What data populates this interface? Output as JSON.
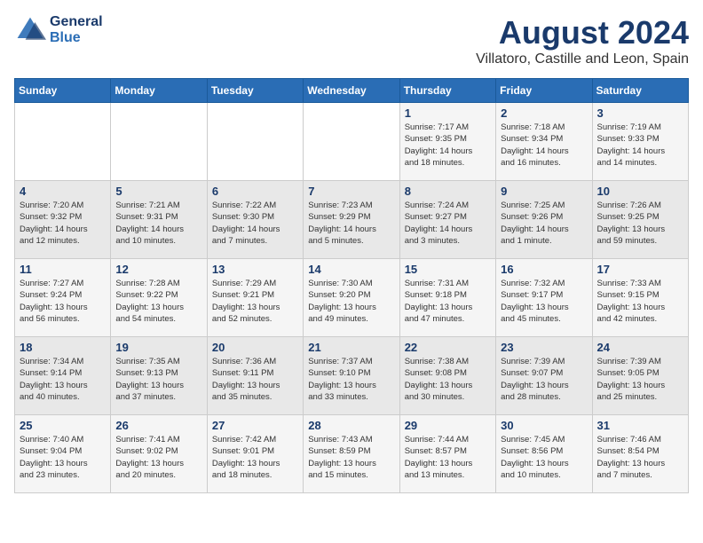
{
  "header": {
    "logo_line1": "General",
    "logo_line2": "Blue",
    "month_year": "August 2024",
    "location": "Villatoro, Castille and Leon, Spain"
  },
  "weekdays": [
    "Sunday",
    "Monday",
    "Tuesday",
    "Wednesday",
    "Thursday",
    "Friday",
    "Saturday"
  ],
  "weeks": [
    [
      {
        "day": "",
        "content": ""
      },
      {
        "day": "",
        "content": ""
      },
      {
        "day": "",
        "content": ""
      },
      {
        "day": "",
        "content": ""
      },
      {
        "day": "1",
        "content": "Sunrise: 7:17 AM\nSunset: 9:35 PM\nDaylight: 14 hours\nand 18 minutes."
      },
      {
        "day": "2",
        "content": "Sunrise: 7:18 AM\nSunset: 9:34 PM\nDaylight: 14 hours\nand 16 minutes."
      },
      {
        "day": "3",
        "content": "Sunrise: 7:19 AM\nSunset: 9:33 PM\nDaylight: 14 hours\nand 14 minutes."
      }
    ],
    [
      {
        "day": "4",
        "content": "Sunrise: 7:20 AM\nSunset: 9:32 PM\nDaylight: 14 hours\nand 12 minutes."
      },
      {
        "day": "5",
        "content": "Sunrise: 7:21 AM\nSunset: 9:31 PM\nDaylight: 14 hours\nand 10 minutes."
      },
      {
        "day": "6",
        "content": "Sunrise: 7:22 AM\nSunset: 9:30 PM\nDaylight: 14 hours\nand 7 minutes."
      },
      {
        "day": "7",
        "content": "Sunrise: 7:23 AM\nSunset: 9:29 PM\nDaylight: 14 hours\nand 5 minutes."
      },
      {
        "day": "8",
        "content": "Sunrise: 7:24 AM\nSunset: 9:27 PM\nDaylight: 14 hours\nand 3 minutes."
      },
      {
        "day": "9",
        "content": "Sunrise: 7:25 AM\nSunset: 9:26 PM\nDaylight: 14 hours\nand 1 minute."
      },
      {
        "day": "10",
        "content": "Sunrise: 7:26 AM\nSunset: 9:25 PM\nDaylight: 13 hours\nand 59 minutes."
      }
    ],
    [
      {
        "day": "11",
        "content": "Sunrise: 7:27 AM\nSunset: 9:24 PM\nDaylight: 13 hours\nand 56 minutes."
      },
      {
        "day": "12",
        "content": "Sunrise: 7:28 AM\nSunset: 9:22 PM\nDaylight: 13 hours\nand 54 minutes."
      },
      {
        "day": "13",
        "content": "Sunrise: 7:29 AM\nSunset: 9:21 PM\nDaylight: 13 hours\nand 52 minutes."
      },
      {
        "day": "14",
        "content": "Sunrise: 7:30 AM\nSunset: 9:20 PM\nDaylight: 13 hours\nand 49 minutes."
      },
      {
        "day": "15",
        "content": "Sunrise: 7:31 AM\nSunset: 9:18 PM\nDaylight: 13 hours\nand 47 minutes."
      },
      {
        "day": "16",
        "content": "Sunrise: 7:32 AM\nSunset: 9:17 PM\nDaylight: 13 hours\nand 45 minutes."
      },
      {
        "day": "17",
        "content": "Sunrise: 7:33 AM\nSunset: 9:15 PM\nDaylight: 13 hours\nand 42 minutes."
      }
    ],
    [
      {
        "day": "18",
        "content": "Sunrise: 7:34 AM\nSunset: 9:14 PM\nDaylight: 13 hours\nand 40 minutes."
      },
      {
        "day": "19",
        "content": "Sunrise: 7:35 AM\nSunset: 9:13 PM\nDaylight: 13 hours\nand 37 minutes."
      },
      {
        "day": "20",
        "content": "Sunrise: 7:36 AM\nSunset: 9:11 PM\nDaylight: 13 hours\nand 35 minutes."
      },
      {
        "day": "21",
        "content": "Sunrise: 7:37 AM\nSunset: 9:10 PM\nDaylight: 13 hours\nand 33 minutes."
      },
      {
        "day": "22",
        "content": "Sunrise: 7:38 AM\nSunset: 9:08 PM\nDaylight: 13 hours\nand 30 minutes."
      },
      {
        "day": "23",
        "content": "Sunrise: 7:39 AM\nSunset: 9:07 PM\nDaylight: 13 hours\nand 28 minutes."
      },
      {
        "day": "24",
        "content": "Sunrise: 7:39 AM\nSunset: 9:05 PM\nDaylight: 13 hours\nand 25 minutes."
      }
    ],
    [
      {
        "day": "25",
        "content": "Sunrise: 7:40 AM\nSunset: 9:04 PM\nDaylight: 13 hours\nand 23 minutes."
      },
      {
        "day": "26",
        "content": "Sunrise: 7:41 AM\nSunset: 9:02 PM\nDaylight: 13 hours\nand 20 minutes."
      },
      {
        "day": "27",
        "content": "Sunrise: 7:42 AM\nSunset: 9:01 PM\nDaylight: 13 hours\nand 18 minutes."
      },
      {
        "day": "28",
        "content": "Sunrise: 7:43 AM\nSunset: 8:59 PM\nDaylight: 13 hours\nand 15 minutes."
      },
      {
        "day": "29",
        "content": "Sunrise: 7:44 AM\nSunset: 8:57 PM\nDaylight: 13 hours\nand 13 minutes."
      },
      {
        "day": "30",
        "content": "Sunrise: 7:45 AM\nSunset: 8:56 PM\nDaylight: 13 hours\nand 10 minutes."
      },
      {
        "day": "31",
        "content": "Sunrise: 7:46 AM\nSunset: 8:54 PM\nDaylight: 13 hours\nand 7 minutes."
      }
    ]
  ]
}
